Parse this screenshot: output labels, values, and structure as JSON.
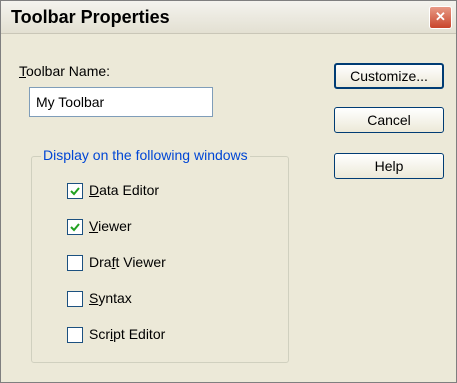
{
  "dialog": {
    "title": "Toolbar Properties",
    "close_glyph": "✕"
  },
  "toolbar_name": {
    "label_mnemonic": "T",
    "label_rest": "oolbar Name:",
    "value": "My Toolbar"
  },
  "buttons": {
    "customize": "Customize...",
    "cancel": "Cancel",
    "help": "Help"
  },
  "display_group": {
    "legend": "Display on the following windows",
    "items": [
      {
        "pre": "",
        "mnemonic": "D",
        "post": "ata Editor",
        "checked": true
      },
      {
        "pre": "",
        "mnemonic": "V",
        "post": "iewer",
        "checked": true
      },
      {
        "pre": "Dra",
        "mnemonic": "f",
        "post": "t Viewer",
        "checked": false
      },
      {
        "pre": "",
        "mnemonic": "S",
        "post": "yntax",
        "checked": false
      },
      {
        "pre": "Scr",
        "mnemonic": "i",
        "post": "pt Editor",
        "checked": false
      }
    ]
  },
  "colors": {
    "dialog_bg": "#ece9d8",
    "legend_text": "#0046d5",
    "checkmark": "#21a121",
    "close_button": "#c9452c"
  },
  "icons": {
    "close": "close-icon",
    "check": "checkmark-icon"
  }
}
